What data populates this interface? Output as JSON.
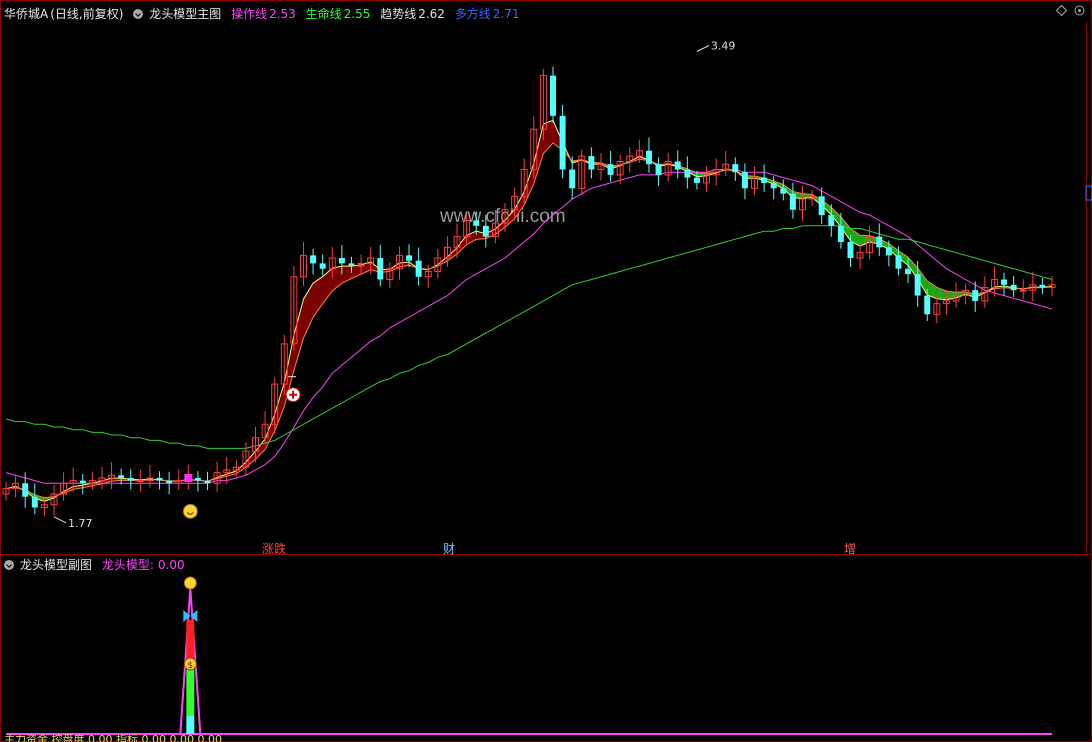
{
  "main_header": {
    "stock": "华侨城A",
    "mode": "(日线,前复权)",
    "panel": "龙头模型主图",
    "indicators": [
      {
        "label": "操作线",
        "value": "2.53",
        "color": "#ff40ff"
      },
      {
        "label": "生命线",
        "value": "2.55",
        "color": "#30ff30"
      },
      {
        "label": "趋势线",
        "value": "2.62",
        "color": "#e0e0e0"
      },
      {
        "label": "多方线",
        "value": "2.71",
        "color": "#4060ff"
      }
    ]
  },
  "sub_header": {
    "panel": "龙头模型副图",
    "indicator_label": "龙头模型",
    "indicator_value": "0.00"
  },
  "watermark": "www.cfchi.com",
  "event_tags": [
    {
      "text": "涨跌",
      "color": "#ff4040"
    },
    {
      "text": "财",
      "color": "#80c0ff"
    },
    {
      "text": "增",
      "color": "#ff6060"
    }
  ],
  "footer_text": "主力资金  控盘度  0.00  指标  0.00  0.00  0.00",
  "colors": {
    "up": "#ff3c3c",
    "down": "#54ffff",
    "band_up": "#7a0000",
    "band_down": "#18a818",
    "ma_magenta": "#ff40ff",
    "ma_green": "#30d030",
    "ma_yellow": "#ffff60"
  },
  "icons": {
    "buy_signal": "plus-circle-icon",
    "smile": "smiley-icon",
    "butterfly": "butterfly-icon",
    "money": "money-bag-icon",
    "dash_marker": "dash-icon"
  },
  "chart_data": [
    {
      "type": "candlestick",
      "title": "龙头模型主图",
      "ylim": [
        1.65,
        3.6
      ],
      "annotations": [
        {
          "text": "3.49",
          "bar": 72,
          "price": 3.49
        },
        {
          "text": "1.77",
          "bar": 5,
          "price": 1.77
        }
      ],
      "closes": [
        1.86,
        1.88,
        1.83,
        1.79,
        1.8,
        1.84,
        1.88,
        1.89,
        1.88,
        1.89,
        1.9,
        1.91,
        1.9,
        1.89,
        1.89,
        1.9,
        1.89,
        1.88,
        1.89,
        1.9,
        1.89,
        1.88,
        1.92,
        1.93,
        1.94,
        2.0,
        2.05,
        2.1,
        2.25,
        2.4,
        2.65,
        2.73,
        2.7,
        2.68,
        2.72,
        2.7,
        2.69,
        2.7,
        2.72,
        2.64,
        2.68,
        2.73,
        2.71,
        2.65,
        2.67,
        2.72,
        2.76,
        2.8,
        2.86,
        2.84,
        2.8,
        2.85,
        2.9,
        2.95,
        3.05,
        3.2,
        3.4,
        3.25,
        3.05,
        2.98,
        3.1,
        3.05,
        3.07,
        3.03,
        3.08,
        3.1,
        3.12,
        3.07,
        3.03,
        3.08,
        3.05,
        3.02,
        3.0,
        3.03,
        3.05,
        3.07,
        3.04,
        2.98,
        3.02,
        3.0,
        2.98,
        2.96,
        2.9,
        2.94,
        2.95,
        2.88,
        2.84,
        2.78,
        2.72,
        2.74,
        2.8,
        2.76,
        2.73,
        2.68,
        2.66,
        2.58,
        2.51,
        2.55,
        2.56,
        2.58,
        2.6,
        2.56,
        2.61,
        2.64,
        2.62,
        2.6,
        2.6,
        2.62,
        2.61,
        2.62
      ],
      "series": [
        {
          "name": "操作线",
          "color": "#ff40ff",
          "values": [
            1.92,
            1.91,
            1.9,
            1.89,
            1.88,
            1.88,
            1.88,
            1.88,
            1.88,
            1.88,
            1.88,
            1.88,
            1.88,
            1.88,
            1.88,
            1.88,
            1.88,
            1.88,
            1.88,
            1.88,
            1.88,
            1.88,
            1.89,
            1.89,
            1.9,
            1.91,
            1.93,
            1.95,
            1.98,
            2.03,
            2.09,
            2.15,
            2.2,
            2.24,
            2.29,
            2.32,
            2.35,
            2.38,
            2.41,
            2.43,
            2.46,
            2.48,
            2.5,
            2.52,
            2.54,
            2.56,
            2.58,
            2.61,
            2.64,
            2.66,
            2.68,
            2.7,
            2.72,
            2.75,
            2.78,
            2.81,
            2.85,
            2.88,
            2.91,
            2.94,
            2.96,
            2.98,
            2.99,
            3.0,
            3.01,
            3.02,
            3.03,
            3.03,
            3.03,
            3.04,
            3.04,
            3.04,
            3.04,
            3.04,
            3.05,
            3.05,
            3.05,
            3.04,
            3.04,
            3.04,
            3.03,
            3.02,
            3.01,
            3.0,
            2.99,
            2.97,
            2.95,
            2.93,
            2.91,
            2.89,
            2.88,
            2.86,
            2.84,
            2.82,
            2.8,
            2.77,
            2.74,
            2.71,
            2.68,
            2.66,
            2.64,
            2.62,
            2.6,
            2.59,
            2.58,
            2.57,
            2.56,
            2.55,
            2.54,
            2.53
          ]
        },
        {
          "name": "生命线",
          "color": "#30d030",
          "values": [
            2.12,
            2.11,
            2.11,
            2.1,
            2.1,
            2.09,
            2.09,
            2.08,
            2.08,
            2.07,
            2.07,
            2.06,
            2.06,
            2.05,
            2.05,
            2.04,
            2.04,
            2.03,
            2.03,
            2.02,
            2.02,
            2.01,
            2.01,
            2.01,
            2.01,
            2.01,
            2.02,
            2.03,
            2.04,
            2.06,
            2.08,
            2.1,
            2.12,
            2.14,
            2.16,
            2.18,
            2.2,
            2.22,
            2.24,
            2.26,
            2.27,
            2.29,
            2.3,
            2.32,
            2.33,
            2.35,
            2.36,
            2.38,
            2.4,
            2.42,
            2.44,
            2.46,
            2.48,
            2.5,
            2.52,
            2.54,
            2.56,
            2.58,
            2.6,
            2.62,
            2.63,
            2.64,
            2.65,
            2.66,
            2.67,
            2.68,
            2.69,
            2.7,
            2.71,
            2.72,
            2.73,
            2.74,
            2.75,
            2.76,
            2.77,
            2.78,
            2.79,
            2.8,
            2.81,
            2.82,
            2.82,
            2.83,
            2.83,
            2.84,
            2.84,
            2.84,
            2.84,
            2.84,
            2.83,
            2.83,
            2.82,
            2.81,
            2.8,
            2.79,
            2.79,
            2.78,
            2.77,
            2.76,
            2.75,
            2.74,
            2.73,
            2.72,
            2.71,
            2.7,
            2.69,
            2.68,
            2.67,
            2.66,
            2.65,
            2.64
          ]
        }
      ]
    },
    {
      "type": "bar",
      "title": "龙头模型副图",
      "series": [
        {
          "name": "龙头模型",
          "values": [
            0.0
          ]
        }
      ]
    }
  ]
}
